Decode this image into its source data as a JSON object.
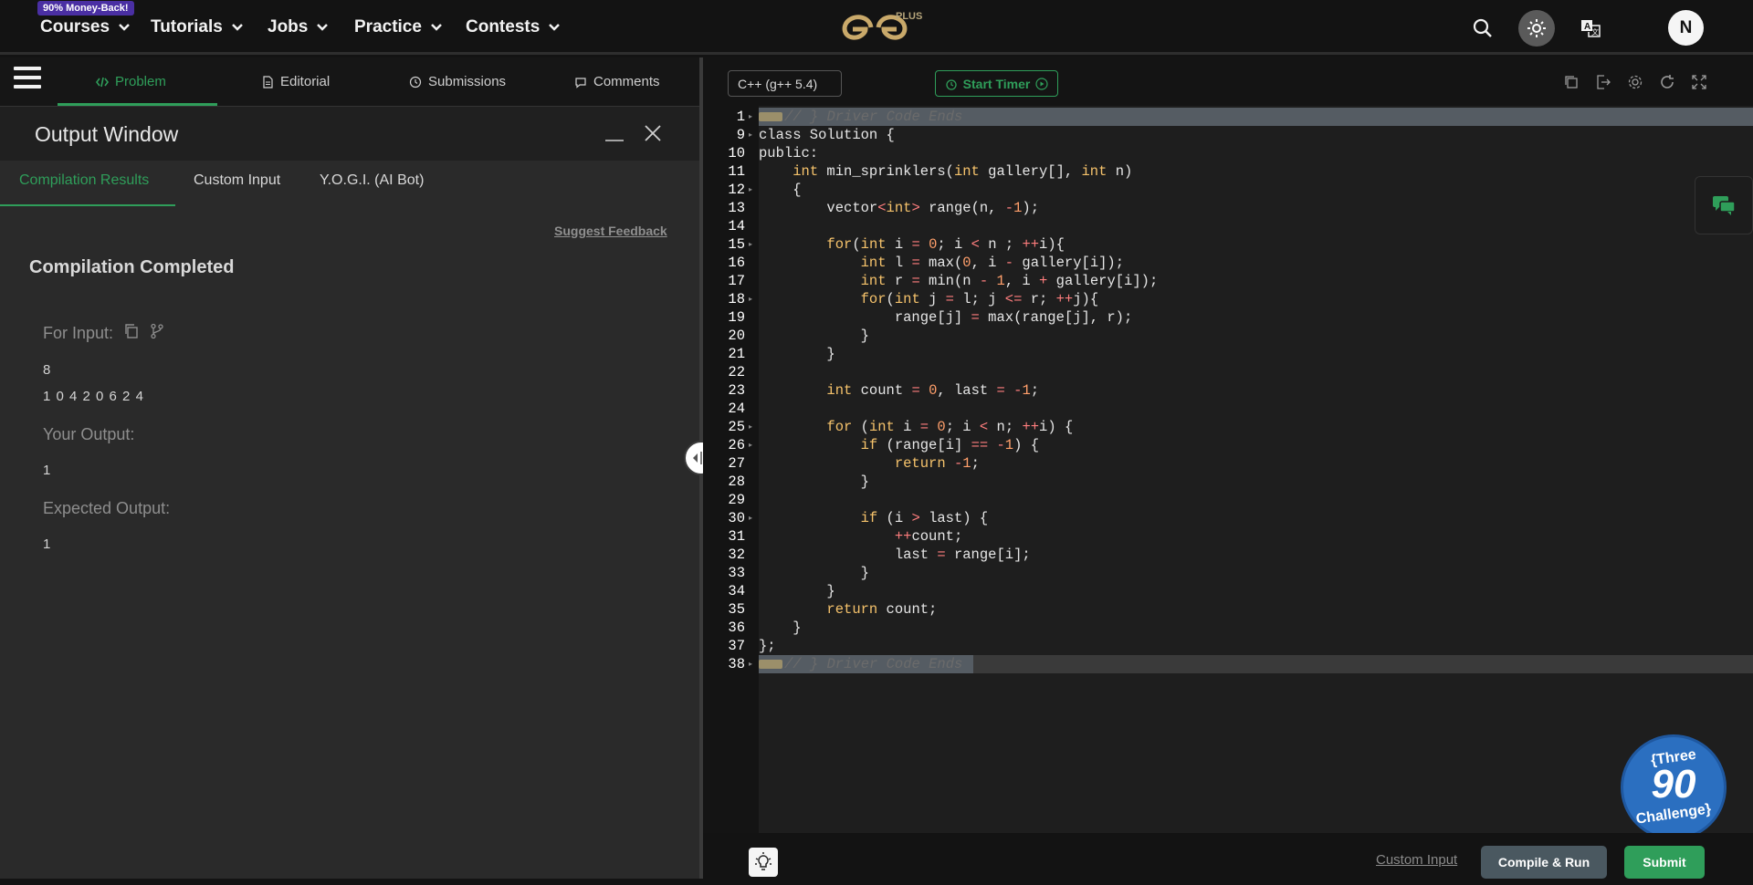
{
  "topnav": {
    "promo_badge": "90% Money-Back!",
    "items": [
      {
        "label": "Courses"
      },
      {
        "label": "Tutorials"
      },
      {
        "label": "Jobs"
      },
      {
        "label": "Practice"
      },
      {
        "label": "Contests"
      }
    ],
    "logo_suffix": "PLUS",
    "avatar_initial": "N"
  },
  "problem_tabs": [
    {
      "label": "Problem",
      "active": true
    },
    {
      "label": "Editorial"
    },
    {
      "label": "Submissions"
    },
    {
      "label": "Comments"
    }
  ],
  "output_window": {
    "title": "Output Window",
    "tabs": [
      {
        "label": "Compilation Results",
        "active": true
      },
      {
        "label": "Custom Input"
      },
      {
        "label": "Y.O.G.I. (AI Bot)"
      }
    ],
    "suggest_feedback": "Suggest Feedback",
    "status": "Compilation Completed",
    "for_input_label": "For Input:",
    "input_line1": "8",
    "input_line2": "1 0 4 2 0 6 2 4",
    "your_output_label": "Your Output:",
    "your_output_value": "1",
    "expected_output_label": "Expected Output:",
    "expected_output_value": "1"
  },
  "editor": {
    "language": "C++ (g++ 5.4)",
    "start_timer": "Start Timer",
    "code_lines": [
      {
        "n": "1",
        "fold": true,
        "tag": true,
        "hl": "full",
        "tokens": [
          [
            "cm",
            "// } Driver Code Ends"
          ]
        ]
      },
      {
        "n": "9",
        "fold": true,
        "tokens": [
          [
            "p",
            "class Solution {"
          ]
        ]
      },
      {
        "n": "10",
        "tokens": [
          [
            "p",
            "public:"
          ]
        ]
      },
      {
        "n": "11",
        "tokens": [
          [
            "p",
            "    "
          ],
          [
            "ty",
            "int"
          ],
          [
            "p",
            " min_sprinklers("
          ],
          [
            "ty",
            "int"
          ],
          [
            "p",
            " gallery[], "
          ],
          [
            "ty",
            "int"
          ],
          [
            "p",
            " n)"
          ]
        ]
      },
      {
        "n": "12",
        "fold": true,
        "tokens": [
          [
            "p",
            "    {"
          ]
        ]
      },
      {
        "n": "13",
        "tokens": [
          [
            "p",
            "        vector"
          ],
          [
            "op",
            "<"
          ],
          [
            "ty",
            "int"
          ],
          [
            "op",
            ">"
          ],
          [
            "p",
            " range(n, "
          ],
          [
            "op",
            "-"
          ],
          [
            "num",
            "1"
          ],
          [
            "p",
            ");"
          ]
        ]
      },
      {
        "n": "14",
        "tokens": [
          [
            "p",
            ""
          ]
        ]
      },
      {
        "n": "15",
        "fold": true,
        "tokens": [
          [
            "p",
            "        "
          ],
          [
            "kw",
            "for"
          ],
          [
            "p",
            "("
          ],
          [
            "ty",
            "int"
          ],
          [
            "p",
            " i "
          ],
          [
            "op",
            "="
          ],
          [
            "p",
            " "
          ],
          [
            "num",
            "0"
          ],
          [
            "p",
            "; i "
          ],
          [
            "op",
            "<"
          ],
          [
            "p",
            " n ; "
          ],
          [
            "op",
            "++"
          ],
          [
            "p",
            "i){"
          ]
        ]
      },
      {
        "n": "16",
        "tokens": [
          [
            "p",
            "            "
          ],
          [
            "ty",
            "int"
          ],
          [
            "p",
            " l "
          ],
          [
            "op",
            "="
          ],
          [
            "p",
            " max("
          ],
          [
            "num",
            "0"
          ],
          [
            "p",
            ", i "
          ],
          [
            "op",
            "-"
          ],
          [
            "p",
            " gallery[i]);"
          ]
        ]
      },
      {
        "n": "17",
        "tokens": [
          [
            "p",
            "            "
          ],
          [
            "ty",
            "int"
          ],
          [
            "p",
            " r "
          ],
          [
            "op",
            "="
          ],
          [
            "p",
            " min(n "
          ],
          [
            "op",
            "-"
          ],
          [
            "p",
            " "
          ],
          [
            "num",
            "1"
          ],
          [
            "p",
            ", i "
          ],
          [
            "op",
            "+"
          ],
          [
            "p",
            " gallery[i]);"
          ]
        ]
      },
      {
        "n": "18",
        "fold": true,
        "tokens": [
          [
            "p",
            "            "
          ],
          [
            "kw",
            "for"
          ],
          [
            "p",
            "("
          ],
          [
            "ty",
            "int"
          ],
          [
            "p",
            " j "
          ],
          [
            "op",
            "="
          ],
          [
            "p",
            " l; j "
          ],
          [
            "op",
            "<="
          ],
          [
            "p",
            " r; "
          ],
          [
            "op",
            "++"
          ],
          [
            "p",
            "j){"
          ]
        ]
      },
      {
        "n": "19",
        "tokens": [
          [
            "p",
            "                range[j] "
          ],
          [
            "op",
            "="
          ],
          [
            "p",
            " max(range[j], r);"
          ]
        ]
      },
      {
        "n": "20",
        "tokens": [
          [
            "p",
            "            }"
          ]
        ]
      },
      {
        "n": "21",
        "tokens": [
          [
            "p",
            "        }"
          ]
        ]
      },
      {
        "n": "22",
        "tokens": [
          [
            "p",
            ""
          ]
        ]
      },
      {
        "n": "23",
        "tokens": [
          [
            "p",
            "        "
          ],
          [
            "ty",
            "int"
          ],
          [
            "p",
            " count "
          ],
          [
            "op",
            "="
          ],
          [
            "p",
            " "
          ],
          [
            "num",
            "0"
          ],
          [
            "p",
            ", last "
          ],
          [
            "op",
            "="
          ],
          [
            "p",
            " "
          ],
          [
            "op",
            "-"
          ],
          [
            "num",
            "1"
          ],
          [
            "p",
            ";"
          ]
        ]
      },
      {
        "n": "24",
        "tokens": [
          [
            "p",
            ""
          ]
        ]
      },
      {
        "n": "25",
        "fold": true,
        "tokens": [
          [
            "p",
            "        "
          ],
          [
            "kw",
            "for"
          ],
          [
            "p",
            " ("
          ],
          [
            "ty",
            "int"
          ],
          [
            "p",
            " i "
          ],
          [
            "op",
            "="
          ],
          [
            "p",
            " "
          ],
          [
            "num",
            "0"
          ],
          [
            "p",
            "; i "
          ],
          [
            "op",
            "<"
          ],
          [
            "p",
            " n; "
          ],
          [
            "op",
            "++"
          ],
          [
            "p",
            "i) {"
          ]
        ]
      },
      {
        "n": "26",
        "fold": true,
        "tokens": [
          [
            "p",
            "            "
          ],
          [
            "kw",
            "if"
          ],
          [
            "p",
            " (range[i] "
          ],
          [
            "op",
            "=="
          ],
          [
            "p",
            " "
          ],
          [
            "op",
            "-"
          ],
          [
            "num",
            "1"
          ],
          [
            "p",
            ") {"
          ]
        ]
      },
      {
        "n": "27",
        "tokens": [
          [
            "p",
            "                "
          ],
          [
            "kw",
            "return"
          ],
          [
            "p",
            " "
          ],
          [
            "op",
            "-"
          ],
          [
            "num",
            "1"
          ],
          [
            "p",
            ";"
          ]
        ]
      },
      {
        "n": "28",
        "tokens": [
          [
            "p",
            "            }"
          ]
        ]
      },
      {
        "n": "29",
        "tokens": [
          [
            "p",
            ""
          ]
        ]
      },
      {
        "n": "30",
        "fold": true,
        "tokens": [
          [
            "p",
            "            "
          ],
          [
            "kw",
            "if"
          ],
          [
            "p",
            " (i "
          ],
          [
            "op",
            ">"
          ],
          [
            "p",
            " last) {"
          ]
        ]
      },
      {
        "n": "31",
        "tokens": [
          [
            "p",
            "                "
          ],
          [
            "op",
            "++"
          ],
          [
            "p",
            "count;"
          ]
        ]
      },
      {
        "n": "32",
        "tokens": [
          [
            "p",
            "                last "
          ],
          [
            "op",
            "="
          ],
          [
            "p",
            " range[i];"
          ]
        ]
      },
      {
        "n": "33",
        "tokens": [
          [
            "p",
            "            }"
          ]
        ]
      },
      {
        "n": "34",
        "tokens": [
          [
            "p",
            "        }"
          ]
        ]
      },
      {
        "n": "35",
        "tokens": [
          [
            "p",
            "        "
          ],
          [
            "kw",
            "return"
          ],
          [
            "p",
            " count;"
          ]
        ]
      },
      {
        "n": "36",
        "tokens": [
          [
            "p",
            "    }"
          ]
        ]
      },
      {
        "n": "37",
        "tokens": [
          [
            "p",
            "};"
          ]
        ]
      },
      {
        "n": "38",
        "fold": true,
        "tag": true,
        "hl": "part",
        "tokens": [
          [
            "cm",
            "// } Driver Code Ends"
          ]
        ]
      }
    ]
  },
  "challenge_badge": {
    "top": "{Three",
    "number": "90",
    "bottom": "Challenge}"
  },
  "bottombar": {
    "custom_input": "Custom Input",
    "compile_run": "Compile & Run",
    "submit": "Submit"
  },
  "colors": {
    "accent_green": "#2f9e5a",
    "promo_purple": "#4a2fa3",
    "keyword": "#f5c26b",
    "operator": "#ff7e7e",
    "number": "#ff9f6b"
  },
  "icons": [
    "chevron-down-icon",
    "search-icon",
    "sun-icon",
    "translate-icon",
    "code-icon",
    "document-icon",
    "clock-icon",
    "comment-icon",
    "copy-icon",
    "branch-icon",
    "minimize-icon",
    "close-icon",
    "split-handle-icon",
    "timer-icon",
    "play-icon",
    "duplicate-icon",
    "export-icon",
    "settings-icon",
    "reset-icon",
    "fullscreen-icon",
    "chat-icon",
    "lightbulb-icon"
  ]
}
